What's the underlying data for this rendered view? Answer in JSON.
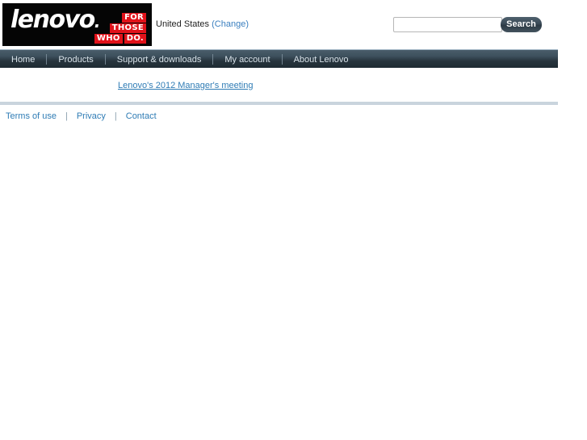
{
  "header": {
    "logo": {
      "wordmark": "lenovo",
      "tagline_rows": [
        [
          "FOR"
        ],
        [
          "THOSE"
        ],
        [
          "WHO",
          "DO."
        ]
      ],
      "background_color": "#050505",
      "tag_color": "#e1121a"
    },
    "locale": {
      "country": "United States",
      "change_open_paren": "(",
      "change_label": "Change",
      "change_close_paren": ")"
    },
    "search": {
      "value": "",
      "placeholder": "",
      "button_label": "Search"
    }
  },
  "nav": {
    "items": [
      {
        "label": "Home"
      },
      {
        "label": "Products"
      },
      {
        "label": "Support & downloads"
      },
      {
        "label": "My account"
      },
      {
        "label": "About Lenovo"
      }
    ]
  },
  "main": {
    "link_label": "Lenovo's 2012 Manager's meeting"
  },
  "footer": {
    "links": [
      {
        "label": "Terms of use"
      },
      {
        "label": "Privacy"
      },
      {
        "label": "Contact"
      }
    ],
    "separator": "|"
  },
  "colors": {
    "nav_dark": "#27343d",
    "link_blue": "#2f7cb5",
    "accent_red": "#e1121a",
    "rule_gray": "#c9d4dd"
  }
}
